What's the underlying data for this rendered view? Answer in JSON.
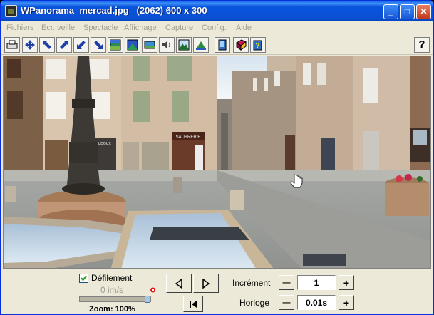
{
  "window": {
    "title": "WPanorama  mercad.jpg   (2062) 600 x 300",
    "minimize_label": "_",
    "maximize_label": "□",
    "close_label": "✕"
  },
  "menu": [
    "Fichiers",
    "Ecr. veille",
    "Spectacle",
    "Affichage",
    "Capture",
    "Config.",
    "Aide"
  ],
  "toolbar": {
    "icons": [
      "print-icon",
      "move-icon",
      "arrow-upleft-icon",
      "arrow-upright-icon",
      "arrow-downleft-icon",
      "arrow-downright-icon",
      "gradient-icon",
      "sky-icon",
      "landscape-icon",
      "speaker-icon",
      "mountain-icon",
      "mountain-alt-icon",
      "page-icon",
      "book-icon",
      "help-book-icon"
    ],
    "help_label": "?"
  },
  "panorama": {
    "shop_sign": "SAUBRERIE",
    "shop_sign2": "AUDOUX"
  },
  "controls": {
    "scroll_label": "Défilement",
    "scroll_checked": true,
    "speed_text": "0 im/s",
    "zoom_label": "Zoom: 100%",
    "zoom_level": 1.0,
    "increment_label": "Incrément",
    "increment_value": "1",
    "clock_label": "Horloge",
    "clock_value": "0.01s",
    "minus_label": "—",
    "plus_label": "+"
  }
}
